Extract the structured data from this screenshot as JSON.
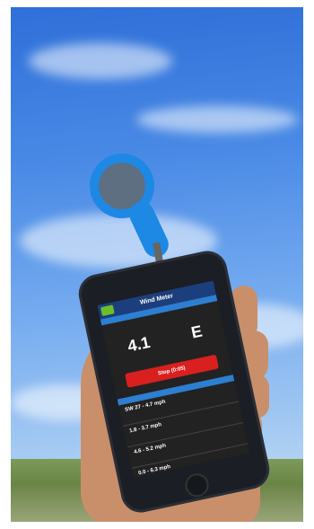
{
  "phone_app": {
    "title": "Wind Meter",
    "speed_value": "4.1",
    "direction_value": "E",
    "stop_label": "Stop (0:05)",
    "readings": [
      "SW 27 - 4.7 mph",
      "1.8 - 3.7 mph",
      "4.6 - 5.2 mph",
      "0.0 - 6.3 mph"
    ]
  }
}
